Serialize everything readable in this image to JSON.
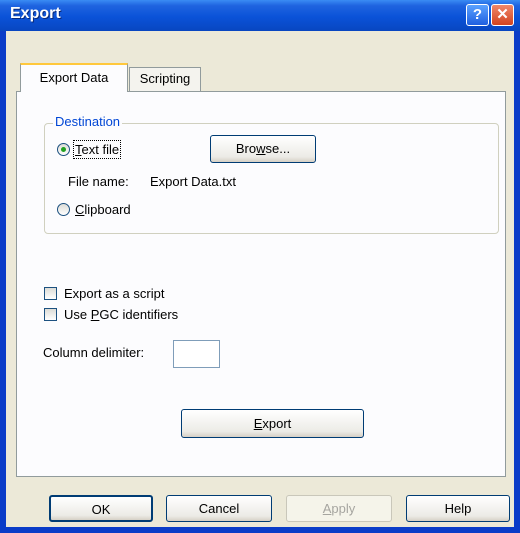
{
  "window": {
    "title": "Export",
    "help_glyph": "?",
    "close_glyph": "✕"
  },
  "tabs": [
    {
      "label": "Export Data",
      "active": true
    },
    {
      "label": "Scripting",
      "active": false
    }
  ],
  "destination": {
    "group_title": "Destination",
    "text_file_label_pre": "",
    "text_file_label_mnemonic": "T",
    "text_file_label_post": "ext file",
    "text_file_selected": true,
    "browse_pre": "Bro",
    "browse_mnemonic": "w",
    "browse_post": "se...",
    "file_name_label": "File name:",
    "file_name_value": "Export Data.txt",
    "clipboard_mnemonic": "C",
    "clipboard_post": "lipboard",
    "clipboard_selected": false
  },
  "options": {
    "export_as_script_label": "Export as a script",
    "export_as_script_checked": false,
    "use_pgc_pre": "Use ",
    "use_pgc_mnemonic": "P",
    "use_pgc_post": "GC identifiers",
    "use_pgc_checked": false,
    "column_delimiter_label": "Column delimiter:",
    "column_delimiter_value": ""
  },
  "export_button": {
    "mnemonic": "E",
    "post": "xport"
  },
  "footer": {
    "ok": "OK",
    "cancel": "Cancel",
    "apply_mnemonic": "A",
    "apply_post": "pply",
    "apply_enabled": false,
    "help": "Help"
  }
}
